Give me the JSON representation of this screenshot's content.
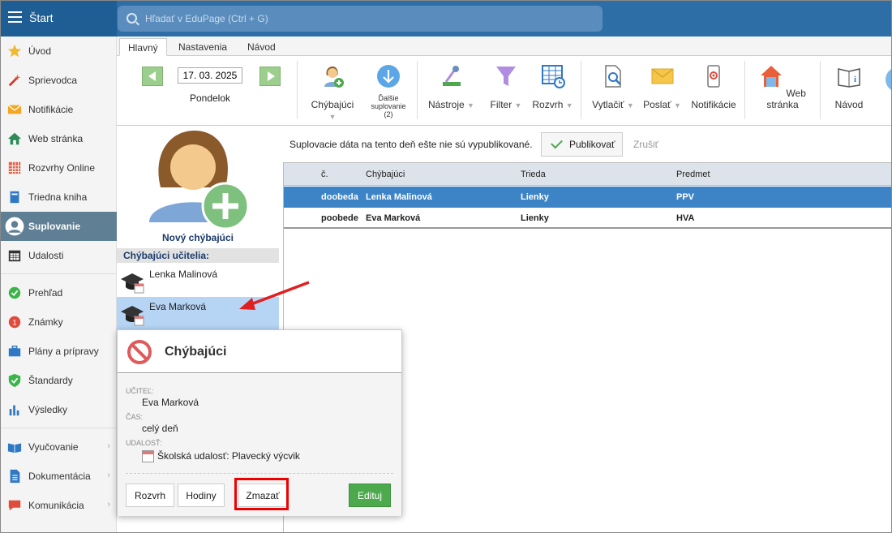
{
  "topbar": {
    "brand_label": "Štart",
    "search_placeholder": "Hľadať v EduPage (Ctrl + G)"
  },
  "sidebar": {
    "items": [
      {
        "label": "Úvod",
        "icon": "star-icon"
      },
      {
        "label": "Sprievodca",
        "icon": "magic-wand-icon"
      },
      {
        "label": "Notifikácie",
        "icon": "envelope-icon"
      },
      {
        "label": "Web stránka",
        "icon": "house-icon"
      },
      {
        "label": "Rozvrhy Online",
        "icon": "timetable-icon"
      },
      {
        "label": "Triedna kniha",
        "icon": "book-icon"
      },
      {
        "label": "Suplovanie",
        "icon": "user-icon",
        "active": true
      },
      {
        "label": "Udalosti",
        "icon": "calendar-icon"
      },
      {
        "label": "Prehľad",
        "icon": "check-circle-icon"
      },
      {
        "label": "Známky",
        "icon": "grades-icon"
      },
      {
        "label": "Plány a prípravy",
        "icon": "briefcase-icon"
      },
      {
        "label": "Štandardy",
        "icon": "shield-check-icon"
      },
      {
        "label": "Výsledky",
        "icon": "bar-chart-icon"
      },
      {
        "label": "Vyučovanie",
        "icon": "open-book-icon"
      },
      {
        "label": "Dokumentácia",
        "icon": "document-icon"
      },
      {
        "label": "Komunikácia",
        "icon": "chat-icon"
      }
    ]
  },
  "tabs": [
    {
      "label": "Hlavný",
      "active": true
    },
    {
      "label": "Nastavenia"
    },
    {
      "label": "Návod"
    }
  ],
  "toolbar": {
    "date_value": "17. 03. 2025",
    "day_label": "Pondelok",
    "tools": [
      {
        "label": "Chýbajúci",
        "icon": "user-add-icon"
      },
      {
        "label": "Ďalšie suplovanie (2)",
        "icon": "arrow-down-circle-icon"
      },
      {
        "label": "Nástroje",
        "icon": "tools-icon"
      },
      {
        "label": "Filter",
        "icon": "funnel-icon"
      },
      {
        "label": "Rozvrh",
        "icon": "timetable-clock-icon"
      },
      {
        "label": "Vytlačiť",
        "icon": "print-preview-icon"
      },
      {
        "label": "Poslať",
        "icon": "envelope-icon"
      },
      {
        "label": "Notifikácie",
        "icon": "phone-icon"
      },
      {
        "label": "Web stránka",
        "icon": "house-icon"
      },
      {
        "label": "Návod",
        "icon": "info-book-icon"
      }
    ]
  },
  "left_panel": {
    "new_absent_label": "Nový chýbajúci",
    "section_title": "Chýbajúci učitelia:",
    "teachers": [
      "Lenka Malinová",
      "Eva Marková"
    ]
  },
  "main": {
    "notice": "Suplovacie dáta na tento deň ešte nie sú vypublikované.",
    "publish_label": "Publikovať",
    "cancel_label": "Zrušiť",
    "table": {
      "headers": [
        "č.",
        "Chýbajúci",
        "Trieda",
        "Predmet"
      ],
      "rows": [
        [
          "doobeda",
          "Lenka Malinová",
          "Lienky",
          "PPV"
        ],
        [
          "poobede",
          "Eva Marková",
          "Lienky",
          "HVA"
        ]
      ]
    }
  },
  "popup": {
    "title": "Chýbajúci",
    "teacher_label": "UČITEĽ:",
    "teacher_value": "Eva Marková",
    "time_label": "ČAS:",
    "time_value": "celý deň",
    "event_label": "UDALOSŤ:",
    "event_value": "Školská udalosť: Plavecký výcvik",
    "buttons": {
      "timetable": "Rozvrh",
      "hours": "Hodiny",
      "delete": "Zmazať",
      "edit": "Edituj"
    }
  },
  "colors": {
    "topbar": "#2e6ea6",
    "active_sidebar": "#5f7f94",
    "selected_row": "#3d84c6",
    "edit_button": "#4caa4c",
    "highlight": "#ee0000"
  }
}
